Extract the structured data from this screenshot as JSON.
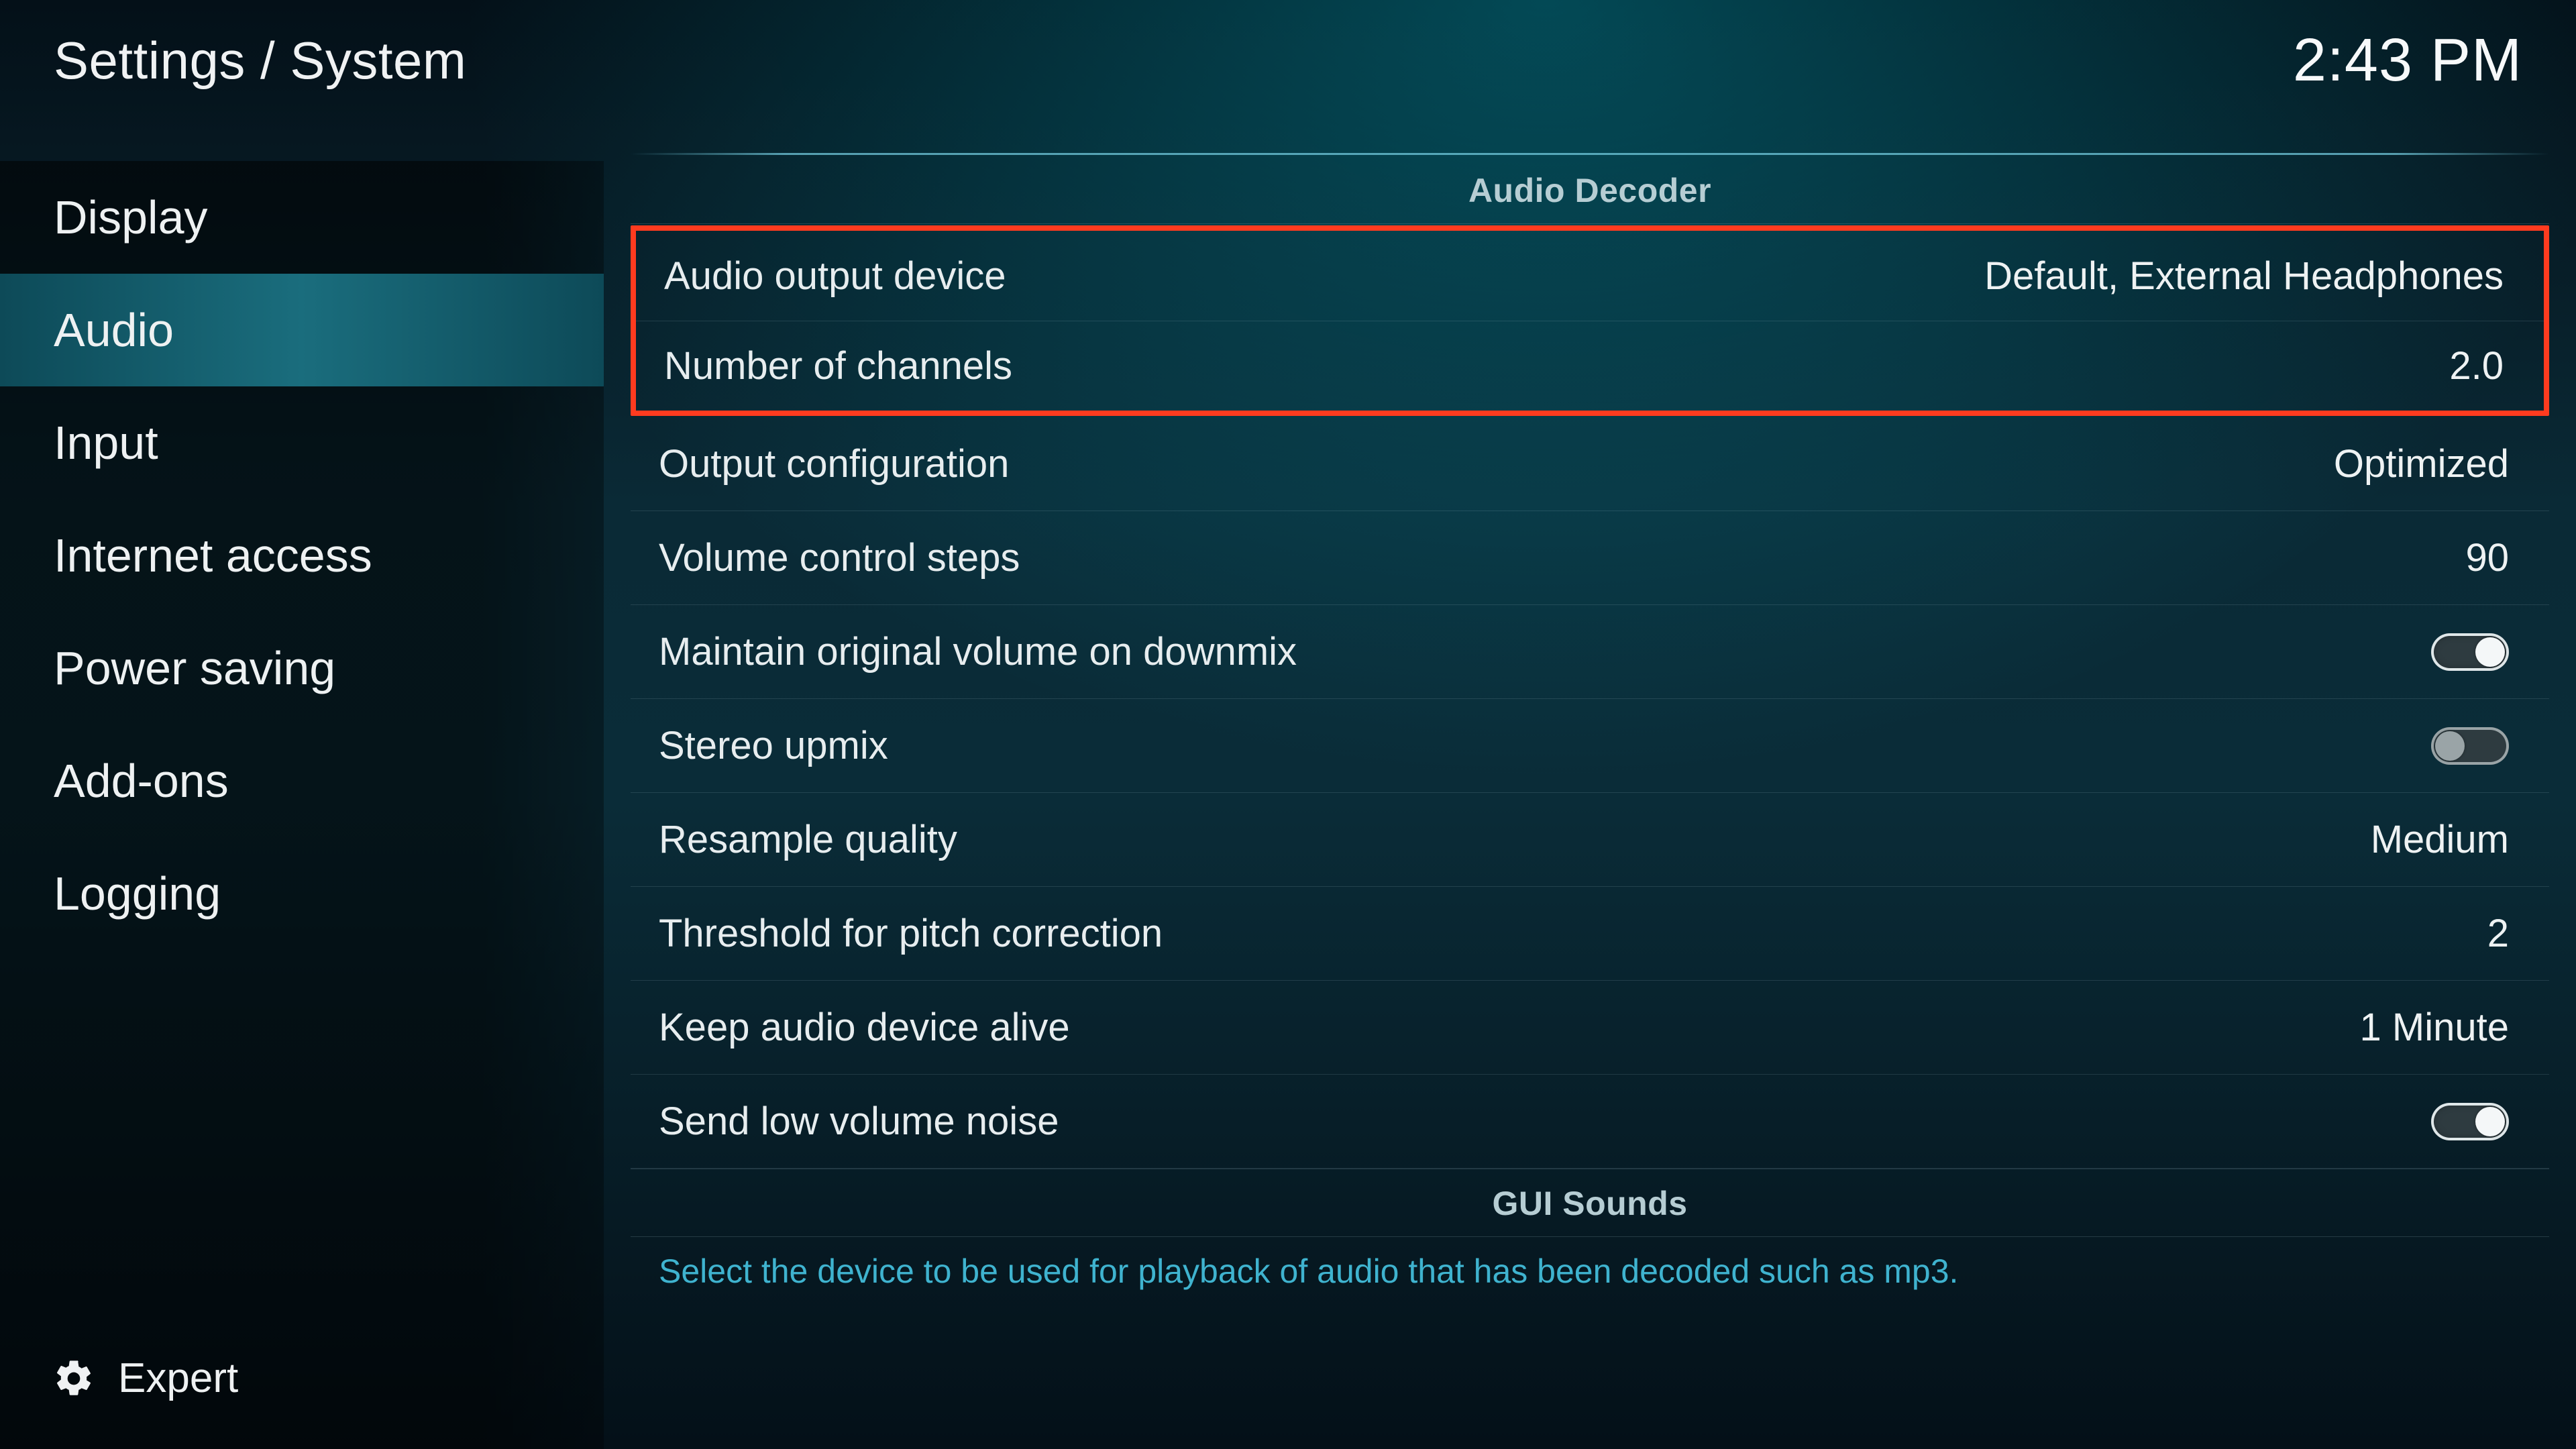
{
  "header": {
    "breadcrumb": "Settings / System",
    "clock": "2:43 PM"
  },
  "sidebar": {
    "items": [
      {
        "label": "Display",
        "active": false
      },
      {
        "label": "Audio",
        "active": true
      },
      {
        "label": "Input",
        "active": false
      },
      {
        "label": "Internet access",
        "active": false
      },
      {
        "label": "Power saving",
        "active": false
      },
      {
        "label": "Add-ons",
        "active": false
      },
      {
        "label": "Logging",
        "active": false
      }
    ],
    "level_label": "Expert"
  },
  "sections": {
    "audio_decoder": {
      "title": "Audio Decoder",
      "rows": [
        {
          "label": "Audio output device",
          "value": "Default, External Headphones",
          "type": "value",
          "highlight": true
        },
        {
          "label": "Number of channels",
          "value": "2.0",
          "type": "value",
          "highlight": true
        },
        {
          "label": "Output configuration",
          "value": "Optimized",
          "type": "value"
        },
        {
          "label": "Volume control steps",
          "value": "90",
          "type": "value"
        },
        {
          "label": "Maintain original volume on downmix",
          "value": true,
          "type": "toggle"
        },
        {
          "label": "Stereo upmix",
          "value": false,
          "type": "toggle"
        },
        {
          "label": "Resample quality",
          "value": "Medium",
          "type": "value"
        },
        {
          "label": "Threshold for pitch correction",
          "value": "2",
          "type": "value"
        },
        {
          "label": "Keep audio device alive",
          "value": "1 Minute",
          "type": "value"
        },
        {
          "label": "Send low volume noise",
          "value": true,
          "type": "toggle"
        }
      ]
    },
    "gui_sounds": {
      "title": "GUI Sounds"
    }
  },
  "description": "Select the device to be used for playback of audio that has been decoded such as mp3."
}
